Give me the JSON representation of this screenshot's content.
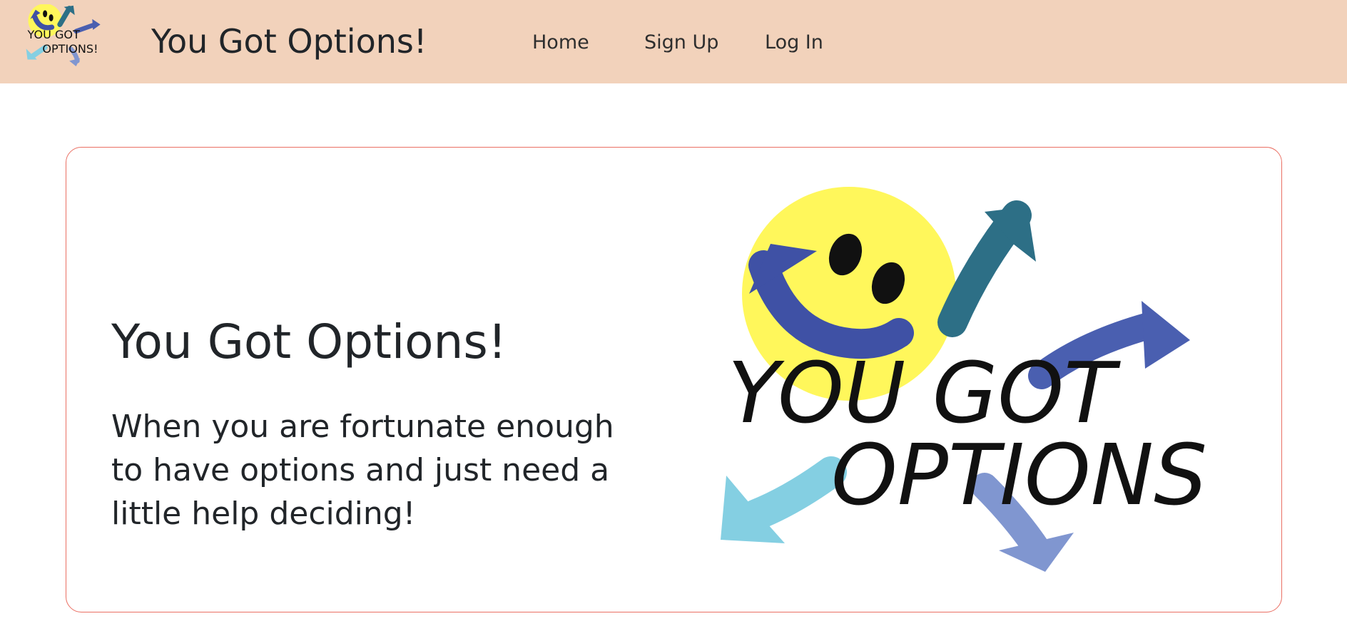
{
  "navbar": {
    "logo_icon": "you-got-options-logo",
    "brand": "You Got Options!",
    "links": [
      "Home",
      "Sign Up",
      "Log In"
    ]
  },
  "hero": {
    "title": "You Got Options!",
    "text": "When you are fortunate enough to have options and just need a little help deciding!",
    "logo_icon": "you-got-options-logo",
    "logo_text_line1": "YOU GOT",
    "logo_text_line2": "OPTIONS!"
  },
  "colors": {
    "navbar_bg": "#f2d2bb",
    "card_border": "#ea6f63",
    "smiley_yellow": "#fff75b",
    "arrow_blue": "#3f51a5",
    "arrow_teal": "#2d6f86",
    "arrow_light_blue": "#84cfe2",
    "arrow_periwinkle": "#8096d0"
  }
}
